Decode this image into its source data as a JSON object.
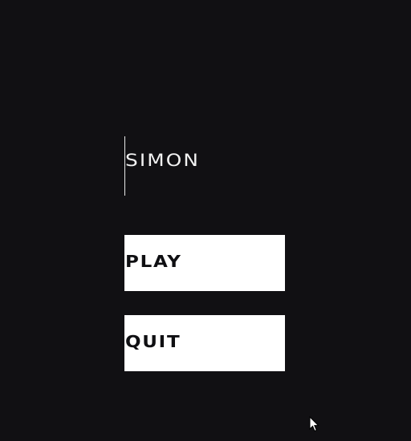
{
  "game": {
    "title": "SIMON"
  },
  "menu": {
    "play_label": "PLAY",
    "quit_label": "QUIT"
  },
  "colors": {
    "background": "#111013",
    "button_fill": "#ffffff",
    "button_text": "#0f0f12",
    "title_text": "#f2f2f2"
  },
  "icons": {
    "cursor": "mouse-pointer-icon"
  }
}
